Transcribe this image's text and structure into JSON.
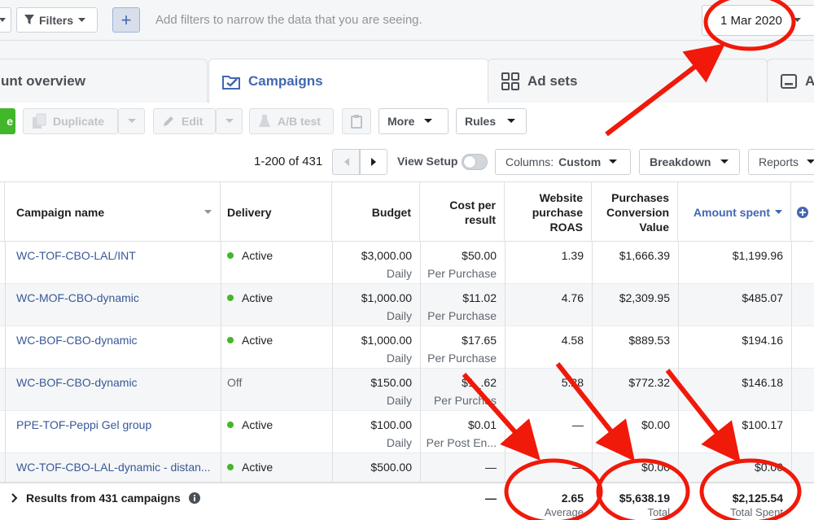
{
  "filterbar": {
    "filters_label": "Filters",
    "plus_label": "+",
    "hint": "Add filters to narrow the data that you are seeing.",
    "date": "1 Mar 2020"
  },
  "tabs": [
    {
      "label": "unt overview"
    },
    {
      "label": "Campaigns"
    },
    {
      "label": "Ad sets"
    },
    {
      "label": "A"
    }
  ],
  "toolbar": {
    "create_label": "e",
    "duplicate_label": "Duplicate",
    "edit_label": "Edit",
    "abtest_label": "A/B test",
    "more_label": "More",
    "rules_label": "Rules"
  },
  "controls": {
    "page_count": "1-200 of 431",
    "view_setup": "View Setup",
    "columns_prefix": "Columns:",
    "columns_value": "Custom",
    "breakdown": "Breakdown",
    "reports": "Reports"
  },
  "table": {
    "headers": {
      "name": "Campaign name",
      "delivery": "Delivery",
      "budget": "Budget",
      "cost_line1": "Cost per",
      "cost_line2": "result",
      "roas_line1": "Website",
      "roas_line2": "purchase",
      "roas_line3": "ROAS",
      "pcv_line1": "Purchases",
      "pcv_line2": "Conversion",
      "pcv_line3": "Value",
      "spent": "Amount spent"
    },
    "rows": [
      {
        "name": "WC-TOF-CBO-LAL/INT",
        "delivery": "Active",
        "budget": "$3,000.00",
        "budget_sub": "Daily",
        "cost": "$50.00",
        "cost_sub": "Per Purchase",
        "roas": "1.39",
        "pcv": "$1,666.39",
        "spent": "$1,199.96"
      },
      {
        "name": "WC-MOF-CBO-dynamic",
        "delivery": "Active",
        "budget": "$1,000.00",
        "budget_sub": "Daily",
        "cost": "$11.02",
        "cost_sub": "Per Purchase",
        "roas": "4.76",
        "pcv": "$2,309.95",
        "spent": "$485.07"
      },
      {
        "name": "WC-BOF-CBO-dynamic",
        "delivery": "Active",
        "budget": "$1,000.00",
        "budget_sub": "Daily",
        "cost": "$17.65",
        "cost_sub": "Per Purchase",
        "roas": "4.58",
        "pcv": "$889.53",
        "spent": "$194.16"
      },
      {
        "name": "WC-BOF-CBO-dynamic",
        "delivery": "Off",
        "budget": "$150.00",
        "budget_sub": "Daily",
        "cost": "$1_.62",
        "cost_sub": "Per Purchas",
        "roas": "5.28",
        "pcv": "$772.32",
        "spent": "$146.18"
      },
      {
        "name": "PPE-TOF-Peppi Gel group",
        "delivery": "Active",
        "budget": "$100.00",
        "budget_sub": "Daily",
        "cost": "$0.01",
        "cost_sub": "Per Post En...",
        "roas": "—",
        "pcv": "$0.00",
        "spent": "$100.17"
      },
      {
        "name": "WC-TOF-CBO-LAL-dynamic - distan...",
        "delivery": "Active",
        "budget": "$500.00",
        "budget_sub": "",
        "cost": "—",
        "cost_sub": "",
        "roas": "—",
        "pcv": "$0.00",
        "spent": "$0.00"
      }
    ],
    "footer": {
      "label": "Results from 431 campaigns",
      "cost": "—",
      "roas": "2.65",
      "roas_sub": "Average",
      "pcv": "$5,638.19",
      "pcv_sub": "Total",
      "spent": "$2,125.54",
      "spent_sub": "Total Spent"
    }
  },
  "colors": {
    "accent": "#4267b2",
    "link": "#385898",
    "active_dot": "#42b72a",
    "annotation": "#f0190a"
  }
}
